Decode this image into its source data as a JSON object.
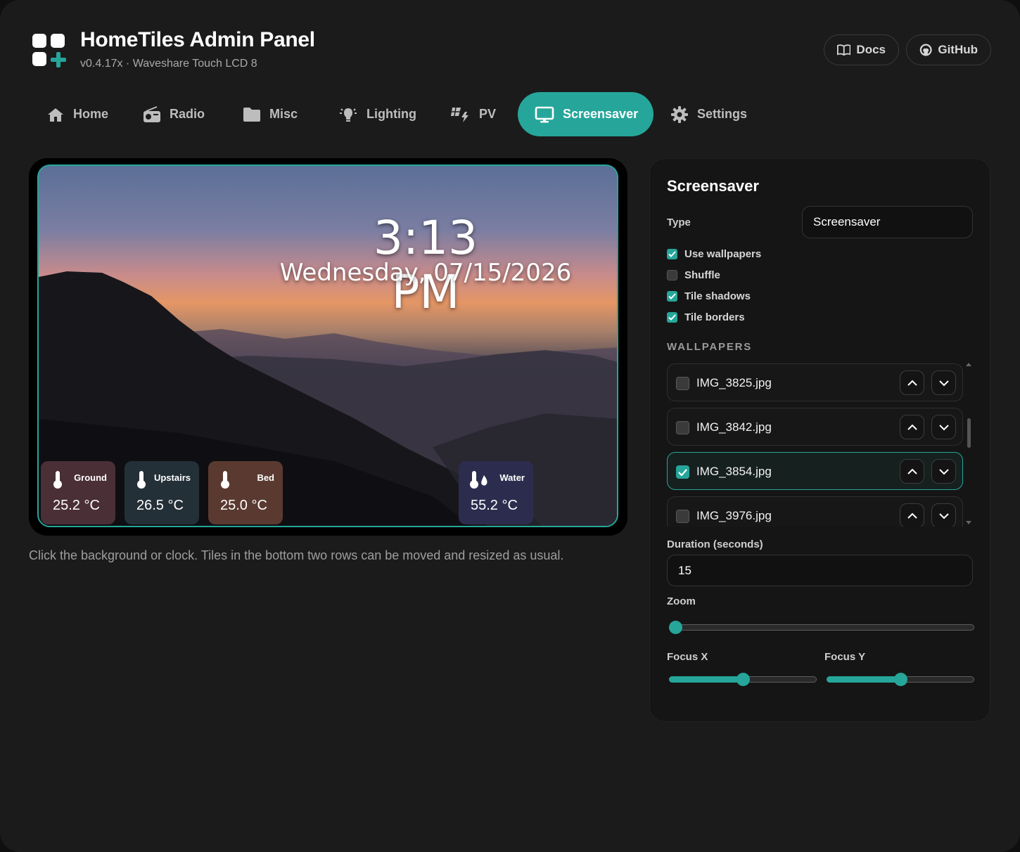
{
  "header": {
    "title": "HomeTiles Admin Panel",
    "subtitle": "v0.4.17x · Waveshare Touch LCD 8",
    "docs_label": "Docs",
    "github_label": "GitHub"
  },
  "tabs": [
    {
      "label": "Home",
      "icon": "home-icon"
    },
    {
      "label": "Radio",
      "icon": "radio-icon"
    },
    {
      "label": "Misc",
      "icon": "folder-icon"
    },
    {
      "label": "Lighting",
      "icon": "lightbulb-icon"
    },
    {
      "label": "PV",
      "icon": "solar-panel-icon"
    },
    {
      "label": "Screensaver",
      "icon": "monitor-icon",
      "active": true
    },
    {
      "label": "Settings",
      "icon": "gear-icon"
    }
  ],
  "preview": {
    "clock": "3:13 PM",
    "date": "Wednesday, 07/15/2026",
    "tiles": [
      {
        "name": "Ground",
        "value": "25.2 °C",
        "color": "#4a2f37",
        "icon": "thermometer-icon"
      },
      {
        "name": "Upstairs",
        "value": "26.5 °C",
        "color": "#243038",
        "icon": "thermometer-icon"
      },
      {
        "name": "Bed",
        "value": "25.0 °C",
        "color": "#5a3a30",
        "icon": "thermometer-icon"
      },
      {
        "name": "Water",
        "value": "55.2 °C",
        "color": "#2c2d4e",
        "icon": "water-temperature-icon"
      }
    ],
    "caption": "Click the background or clock. Tiles in the bottom two rows can be moved and resized as usual."
  },
  "panel": {
    "title": "Screensaver",
    "type_label": "Type",
    "type_value": "Screensaver",
    "options": [
      {
        "label": "Use wallpapers",
        "checked": true
      },
      {
        "label": "Shuffle",
        "checked": false
      },
      {
        "label": "Tile shadows",
        "checked": true
      },
      {
        "label": "Tile borders",
        "checked": true
      }
    ],
    "wallpapers_heading": "WALLPAPERS",
    "wallpapers": [
      {
        "name": "IMG_3825.jpg",
        "checked": false
      },
      {
        "name": "IMG_3842.jpg",
        "checked": false
      },
      {
        "name": "IMG_3854.jpg",
        "checked": true
      },
      {
        "name": "IMG_3976.jpg",
        "checked": false
      }
    ],
    "duration_label": "Duration (seconds)",
    "duration_value": "15",
    "zoom_label": "Zoom",
    "zoom_value": 0,
    "focus_x_label": "Focus X",
    "focus_x_value": 0.5,
    "focus_y_label": "Focus Y",
    "focus_y_value": 0.5
  },
  "colors": {
    "accent": "#26a69a",
    "background": "#1b1b1b"
  }
}
